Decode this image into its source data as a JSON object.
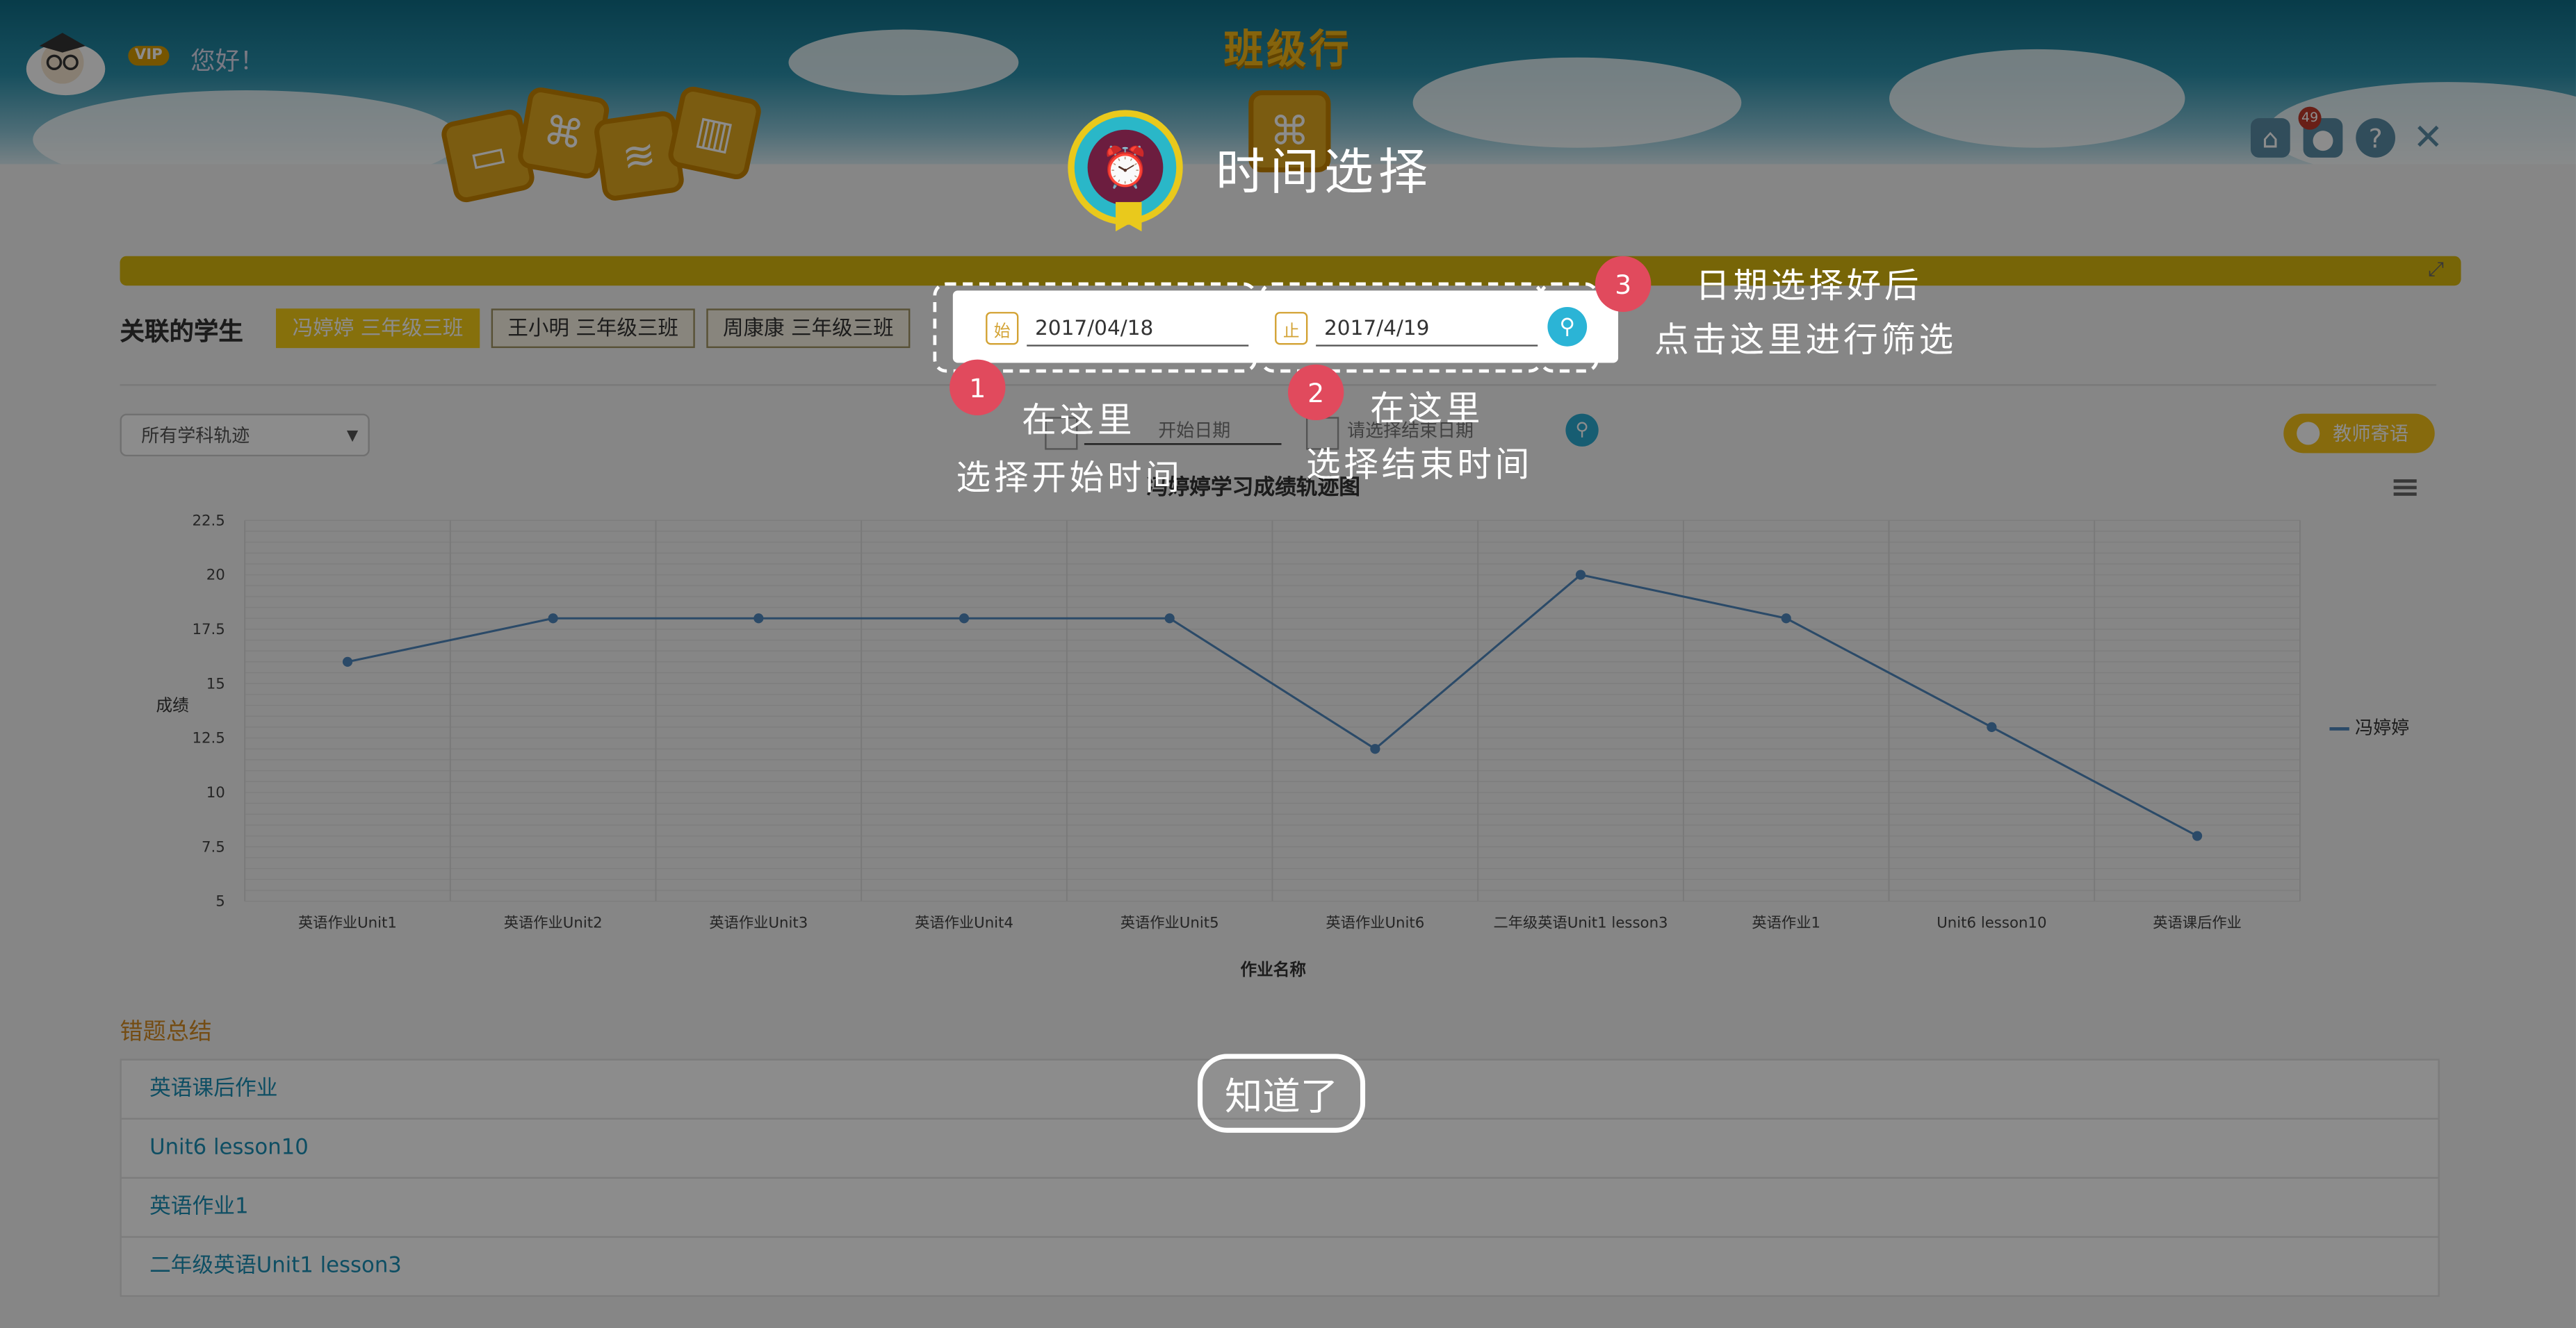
{
  "header": {
    "vip": "VIP",
    "greeting": "您好！",
    "title": "班级行",
    "notification_count": "49",
    "icons": [
      "home-icon",
      "user-icon",
      "help-icon",
      "close-icon"
    ]
  },
  "students": {
    "label": "关联的学生",
    "items": [
      {
        "label": "冯婷婷 三年级三班",
        "active": true
      },
      {
        "label": "王小明 三年级三班",
        "active": false
      },
      {
        "label": "周康康 三年级三班",
        "active": false
      }
    ]
  },
  "filters": {
    "subject_select": "所有学科轨迹",
    "start_placeholder": "开始日期",
    "end_placeholder": "请选择结束日期",
    "teacher_button": "教师寄语"
  },
  "chart_data": {
    "type": "line",
    "title": "冯婷婷学习成绩轨迹图",
    "xlabel": "作业名称",
    "ylabel": "成绩",
    "categories": [
      "英语作业Unit1",
      "英语作业Unit2",
      "英语作业Unit3",
      "英语作业Unit4",
      "英语作业Unit5",
      "英语作业Unit6",
      "二年级英语Unit1 lesson3",
      "英语作业1",
      "Unit6 lesson10",
      "英语课后作业"
    ],
    "series": [
      {
        "name": "冯婷婷",
        "values": [
          16,
          18,
          18,
          18,
          18,
          12,
          20,
          18,
          13,
          8
        ]
      }
    ],
    "yticks": [
      "5",
      "7.5",
      "10",
      "12.5",
      "15",
      "17.5",
      "20",
      "22.5"
    ],
    "ylim": [
      5,
      22.5
    ],
    "grid": true,
    "legend": "right",
    "color": "#4f87bd"
  },
  "wrong_summary": {
    "title": "错题总结",
    "items": [
      "英语课后作业",
      "Unit6 lesson10",
      "英语作业1",
      "二年级英语Unit1 lesson3"
    ]
  },
  "guide": {
    "title": "时间选择",
    "start_date": "2017/04/18",
    "end_date": "2017/4/19",
    "start_icon": "始",
    "end_icon": "止",
    "step1_num": "1",
    "step1_line1": "在这里",
    "step1_line2": "选择开始时间",
    "step2_num": "2",
    "step2_line1": "在这里",
    "step2_line2": "选择结束时间",
    "step3_num": "3",
    "step3_line1": "日期选择好后",
    "step3_line2": "点击这里进行筛选",
    "ok_button": "知道了"
  }
}
